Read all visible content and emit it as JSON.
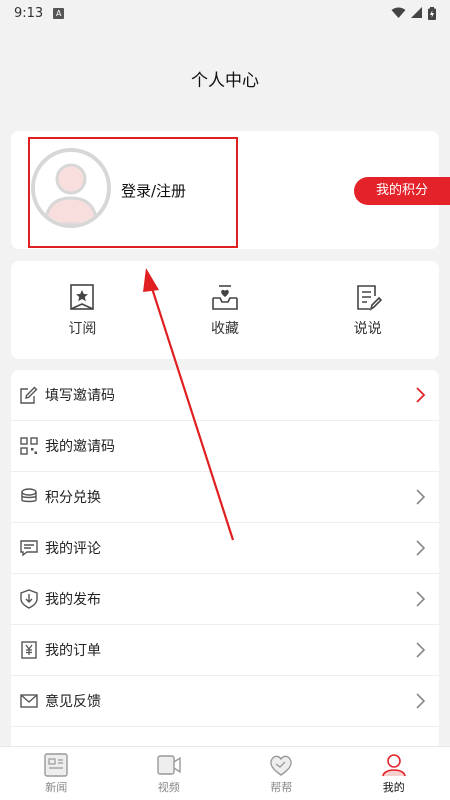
{
  "status_bar": {
    "time": "9:13",
    "sim_label": "A"
  },
  "header": {
    "title": "个人中心"
  },
  "profile": {
    "login_label": "登录/注册",
    "points_button": "我的积分"
  },
  "quick_actions": [
    {
      "label": "订阅",
      "icon": "bookmark-star-icon"
    },
    {
      "label": "收藏",
      "icon": "inbox-heart-icon"
    },
    {
      "label": "说说",
      "icon": "note-pencil-icon"
    }
  ],
  "menu": [
    {
      "label": "填写邀请码",
      "icon": "edit-icon",
      "chevron": "red"
    },
    {
      "label": "我的邀请码",
      "icon": "qrcode-icon",
      "chevron": "none"
    },
    {
      "label": "积分兑换",
      "icon": "coin-stack-icon",
      "chevron": "gray"
    },
    {
      "label": "我的评论",
      "icon": "comment-icon",
      "chevron": "gray"
    },
    {
      "label": "我的发布",
      "icon": "download-shield-icon",
      "chevron": "gray"
    },
    {
      "label": "我的订单",
      "icon": "order-yen-icon",
      "chevron": "gray"
    },
    {
      "label": "意见反馈",
      "icon": "mail-icon",
      "chevron": "gray"
    }
  ],
  "tabs": [
    {
      "label": "新闻",
      "icon": "news-icon",
      "active": false
    },
    {
      "label": "视频",
      "icon": "video-icon",
      "active": false
    },
    {
      "label": "帮帮",
      "icon": "heart-hands-icon",
      "active": false
    },
    {
      "label": "我的",
      "icon": "person-icon",
      "active": true
    }
  ],
  "colors": {
    "accent": "#e3222a",
    "annotation": "#e02020",
    "background": "#f2f2f2"
  }
}
